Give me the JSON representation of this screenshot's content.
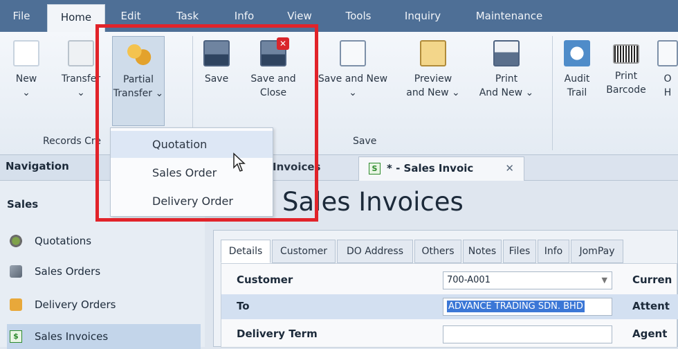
{
  "menubar": {
    "items": [
      "File",
      "Home",
      "Edit",
      "Task",
      "Info",
      "View",
      "Tools",
      "Inquiry",
      "Maintenance"
    ],
    "active": "Home"
  },
  "ribbon": {
    "buttons": {
      "new": "New\n⌄",
      "transfer": "Transfer\n⌄",
      "partial_transfer": "Partial\nTransfer ⌄",
      "save": "Save",
      "save_close": "Save and\nClose",
      "save_new": "Save and New\n⌄",
      "preview_new": "Preview\nand New ⌄",
      "print_new": "Print\nAnd New ⌄",
      "audit_trail": "Audit\nTrail",
      "print_barcode": "Print\nBarcode",
      "cut_off": "O\nH"
    },
    "groups": {
      "records": "Records Cre",
      "save": "Save"
    }
  },
  "dropdown": {
    "items": [
      "Quotation",
      "Sales Order",
      "Delivery Order"
    ],
    "hovered": "Quotation"
  },
  "navigation": {
    "title": "Navigation",
    "section": "Sales",
    "items": [
      "Quotations",
      "Sales Orders",
      "Delivery Orders",
      "Sales Invoices"
    ],
    "selected": "Sales Invoices"
  },
  "doc_tabs": {
    "tab1": "Invoices",
    "tab2": "* - Sales Invoic",
    "tab2_icon": "S",
    "close": "✕"
  },
  "doc_title": "Sales Invoices",
  "panel_tabs": [
    "Details",
    "Customer",
    "DO Address",
    "Others",
    "Notes",
    "Files",
    "Info",
    "JomPay"
  ],
  "form": {
    "customer_label": "Customer",
    "customer_value": "700-A001",
    "to_label": "To",
    "to_value": "ADVANCE TRADING SDN. BHD",
    "delivery_term_label": "Delivery Term",
    "right_labels": [
      "Curren",
      "Attent",
      "Agent"
    ]
  }
}
